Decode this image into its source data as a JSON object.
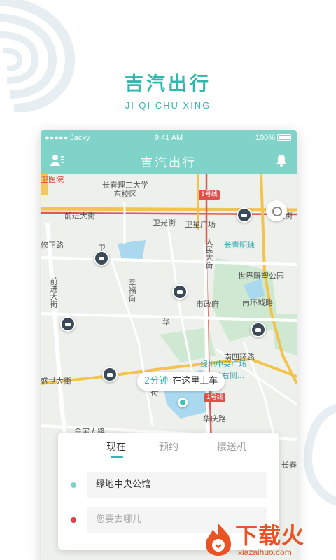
{
  "brand": {
    "name_cn": "吉汽出行",
    "name_en": "JI QI CHU XING"
  },
  "statusbar": {
    "carrier": "●●●●● Jacky",
    "time": "9:41 AM",
    "battery": "100%"
  },
  "navbar": {
    "title": "吉汽出行"
  },
  "map": {
    "labels": {
      "hospital": "卫医院",
      "university": "长春理工大学\n东校区",
      "qianjin_street": "前进大街",
      "weiguang": "卫光街",
      "weixing_square": "卫星广场",
      "dajie": "大街",
      "zhengzheng": "修正路",
      "changchun_pearl": "长春明珠",
      "renmin_street": "人民大街",
      "sculpture_park": "世界雕塑公园",
      "qianjin_vertical": "前进大街",
      "xingfu": "幸福街",
      "city_gov": "市政府",
      "nanhuan": "南环城路",
      "south_fourth_ring": "南四环路",
      "greenland": "绿地中央广场",
      "west_side": "(西门)右侧...",
      "shengshi": "盛世大街",
      "ming_street": "明街",
      "huaqing": "华庆路",
      "jinyu": "金宇大路",
      "changchun_right": "长春",
      "hua": "华",
      "wei": "卫"
    },
    "metro": [
      "1号线",
      "1号线"
    ],
    "pickup": {
      "eta": "2分钟",
      "text": "在这里上车"
    }
  },
  "panel": {
    "tabs": [
      "现在",
      "预约",
      "接送机"
    ],
    "active_tab": "现在",
    "from": "绿地中央公馆",
    "to_placeholder": "您要去哪儿"
  },
  "watermark": {
    "cn": "下载火",
    "en": "xiazaihuo.com"
  },
  "colors": {
    "teal": "#7fd3c8",
    "brand": "#2fb8ae",
    "metro": "#e0504a",
    "destination": "#e0404a",
    "watermark": "#ea5324"
  }
}
